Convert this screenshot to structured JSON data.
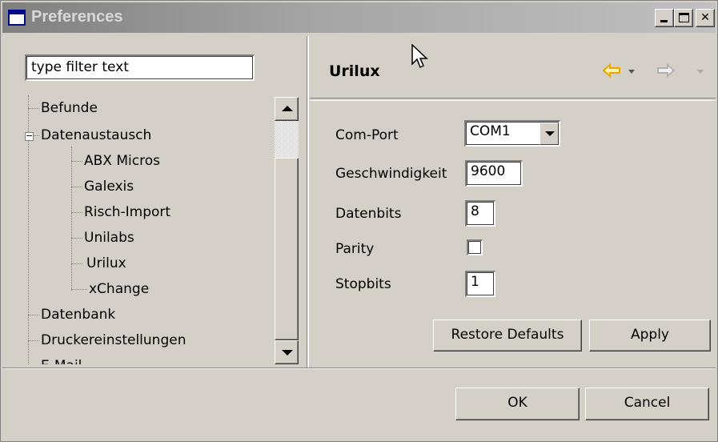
{
  "window": {
    "title": "Preferences"
  },
  "filter": {
    "value": "type filter text"
  },
  "tree": {
    "items": [
      {
        "label": "Befunde"
      },
      {
        "label": "Datenaustausch"
      },
      {
        "label": "ABX Micros"
      },
      {
        "label": "Galexis"
      },
      {
        "label": "Risch-Import"
      },
      {
        "label": "Unilabs"
      },
      {
        "label": "Urilux"
      },
      {
        "label": "xChange"
      },
      {
        "label": "Datenbank"
      },
      {
        "label": "Druckereinstellungen"
      },
      {
        "label": "E-Mail"
      }
    ],
    "selected": "Urilux"
  },
  "page": {
    "title": "Urilux",
    "fields": {
      "com_port_label": "Com-Port",
      "com_port_value": "COM1",
      "speed_label": "Geschwindigkeit",
      "speed_value": "9600",
      "databits_label": "Datenbits",
      "databits_value": "8",
      "parity_label": "Parity",
      "parity_checked": false,
      "stopbits_label": "Stopbits",
      "stopbits_value": "1"
    },
    "restore_defaults": "Restore Defaults",
    "apply": "Apply"
  },
  "dialog": {
    "ok": "OK",
    "cancel": "Cancel"
  },
  "colors": {
    "nav_back": "#e8a800",
    "nav_forward": "#b0b0b0",
    "titlebar": "#808080"
  }
}
